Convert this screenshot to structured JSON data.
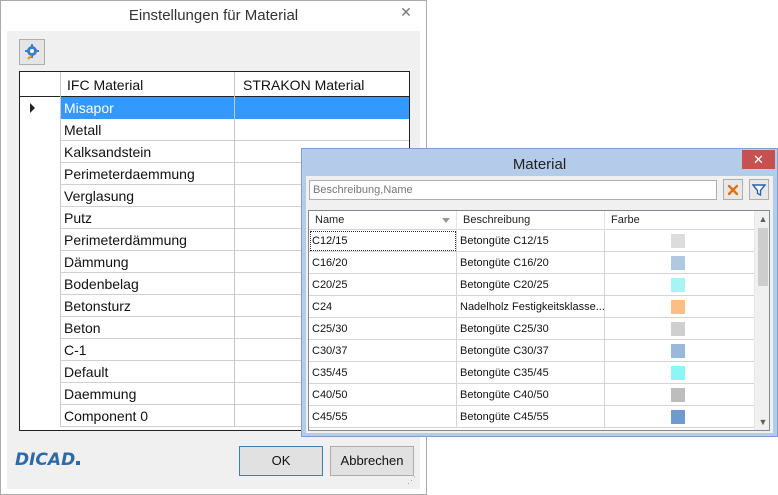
{
  "main_dialog": {
    "title": "Einstellungen für Material",
    "close_glyph": "✕",
    "columns": [
      "IFC Material",
      "STRAKON Material"
    ],
    "rows": [
      {
        "ifc": "Misapor",
        "strakon": "",
        "selected": true
      },
      {
        "ifc": "Metall",
        "strakon": ""
      },
      {
        "ifc": "Kalksandstein",
        "strakon": ""
      },
      {
        "ifc": "Perimeterdaemmung",
        "strakon": ""
      },
      {
        "ifc": "Verglasung",
        "strakon": ""
      },
      {
        "ifc": "Putz",
        "strakon": ""
      },
      {
        "ifc": "Perimeterdämmung",
        "strakon": ""
      },
      {
        "ifc": "Dämmung",
        "strakon": ""
      },
      {
        "ifc": "Bodenbelag",
        "strakon": ""
      },
      {
        "ifc": "Betonsturz",
        "strakon": ""
      },
      {
        "ifc": "Beton",
        "strakon": ""
      },
      {
        "ifc": "C-1",
        "strakon": ""
      },
      {
        "ifc": "Default",
        "strakon": ""
      },
      {
        "ifc": "Daemmung",
        "strakon": ""
      },
      {
        "ifc": "Component 0",
        "strakon": ""
      }
    ],
    "logo_text": "DICAD",
    "ok_label": "OK",
    "cancel_label": "Abbrechen",
    "toolbar_icon": "settings-gear-icon"
  },
  "material_dialog": {
    "title": "Material",
    "close_glyph": "✕",
    "search_placeholder": "Beschreibung,Name",
    "columns": [
      "Name",
      "Beschreibung",
      "Farbe"
    ],
    "rows": [
      {
        "name": "C12/15",
        "desc": "Betongüte C12/15",
        "color": "#dcdcdc"
      },
      {
        "name": "C16/20",
        "desc": "Betongüte C16/20",
        "color": "#b0c8e2"
      },
      {
        "name": "C20/25",
        "desc": "Betongüte C20/25",
        "color": "#a6f4f4"
      },
      {
        "name": "C24",
        "desc": "Nadelholz Festigkeitsklasse...",
        "color": "#fbbf86"
      },
      {
        "name": "C25/30",
        "desc": "Betongüte C25/30",
        "color": "#cfcfcf"
      },
      {
        "name": "C30/37",
        "desc": "Betongüte C30/37",
        "color": "#9ab8dc"
      },
      {
        "name": "C35/45",
        "desc": "Betongüte C35/45",
        "color": "#8cf6f6"
      },
      {
        "name": "C40/50",
        "desc": "Betongüte C40/50",
        "color": "#bdbdbd"
      },
      {
        "name": "C45/55",
        "desc": "Betongüte C45/55",
        "color": "#6f9ad0"
      }
    ],
    "icons": {
      "clear": "clear-x-icon",
      "filter": "filter-funnel-icon"
    },
    "scroll_up_glyph": "▲",
    "scroll_down_glyph": "▼"
  }
}
